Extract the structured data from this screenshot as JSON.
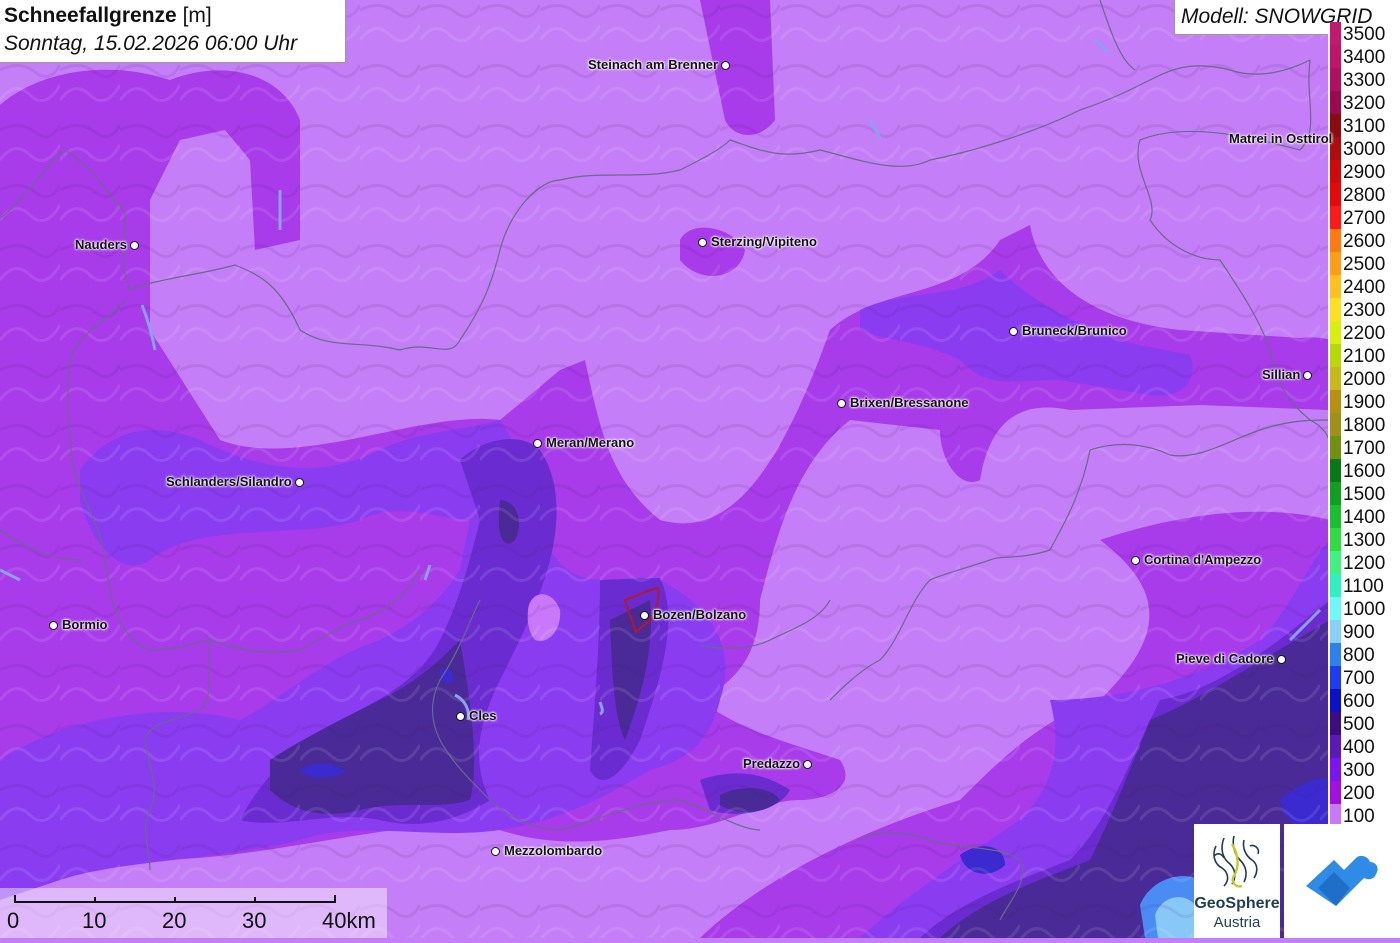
{
  "title": {
    "main": "Schneefallgrenze",
    "unit": "[m]",
    "datetime": "Sonntag, 15.02.2026 06:00 Uhr"
  },
  "model": {
    "label": "Modell: SNOWGRID"
  },
  "legend": {
    "levels": [
      {
        "label": "3500",
        "color": "#c2186e"
      },
      {
        "label": "3400",
        "color": "#c0146a"
      },
      {
        "label": "3300",
        "color": "#b01062"
      },
      {
        "label": "3200",
        "color": "#9a0a50"
      },
      {
        "label": "3100",
        "color": "#8c0a10"
      },
      {
        "label": "3000",
        "color": "#b00c0c"
      },
      {
        "label": "2900",
        "color": "#d00a0a"
      },
      {
        "label": "2800",
        "color": "#e80808"
      },
      {
        "label": "2700",
        "color": "#ff1a1a"
      },
      {
        "label": "2600",
        "color": "#ff7a10"
      },
      {
        "label": "2500",
        "color": "#ff9e16"
      },
      {
        "label": "2400",
        "color": "#ffc020"
      },
      {
        "label": "2300",
        "color": "#ffe020"
      },
      {
        "label": "2200",
        "color": "#d8f010"
      },
      {
        "label": "2100",
        "color": "#b8d808"
      },
      {
        "label": "2000",
        "color": "#c8b818"
      },
      {
        "label": "1900",
        "color": "#b89010"
      },
      {
        "label": "1800",
        "color": "#a09018"
      },
      {
        "label": "1700",
        "color": "#709010"
      },
      {
        "label": "1600",
        "color": "#087818"
      },
      {
        "label": "1500",
        "color": "#10a020"
      },
      {
        "label": "1400",
        "color": "#18c030"
      },
      {
        "label": "1300",
        "color": "#30dc40"
      },
      {
        "label": "1200",
        "color": "#40f080"
      },
      {
        "label": "1100",
        "color": "#30f0c0"
      },
      {
        "label": "1000",
        "color": "#70f8f8"
      },
      {
        "label": "900",
        "color": "#88d0f8"
      },
      {
        "label": "800",
        "color": "#2e80f0"
      },
      {
        "label": "700",
        "color": "#1c3cf0"
      },
      {
        "label": "600",
        "color": "#0c10c8"
      },
      {
        "label": "500",
        "color": "#3c0c80"
      },
      {
        "label": "400",
        "color": "#5c18b8"
      },
      {
        "label": "300",
        "color": "#7a14f0"
      },
      {
        "label": "200",
        "color": "#a010e0"
      },
      {
        "label": "100",
        "color": "#c878f8"
      }
    ]
  },
  "places": [
    {
      "name": "Steinach am Brenner",
      "side": "left"
    },
    {
      "name": "Sterzing/Vipiteno",
      "side": "right"
    },
    {
      "name": "Nauders",
      "side": "left"
    },
    {
      "name": "Matrei in Osttirol",
      "side": "left"
    },
    {
      "name": "Bruneck/Brunico",
      "side": "right"
    },
    {
      "name": "Sillian",
      "side": "left"
    },
    {
      "name": "Brixen/Bressanone",
      "side": "right"
    },
    {
      "name": "Meran/Merano",
      "side": "right"
    },
    {
      "name": "Schlanders/Silandro",
      "side": "left"
    },
    {
      "name": "Cortina d'Ampezzo",
      "side": "right"
    },
    {
      "name": "Bozen/Bolzano",
      "side": "right"
    },
    {
      "name": "Bormio",
      "side": "right"
    },
    {
      "name": "Pieve di Cadore",
      "side": "left"
    },
    {
      "name": "Cles",
      "side": "right"
    },
    {
      "name": "Predazzo",
      "side": "left"
    },
    {
      "name": "Mezzolombardo",
      "side": "right"
    }
  ],
  "scale": {
    "labels": [
      "0",
      "10",
      "20",
      "30",
      "40km"
    ]
  },
  "logos": {
    "geosphere_line1": "GeoSphere",
    "geosphere_line2": "Austria"
  },
  "colors": {
    "base_100": "#c47ef7",
    "band_200": "#a83bea",
    "band_300": "#8a3cf0",
    "band_400": "#6a2cd0",
    "band_500": "#4a2a96",
    "band_600": "#3a2ad0"
  }
}
